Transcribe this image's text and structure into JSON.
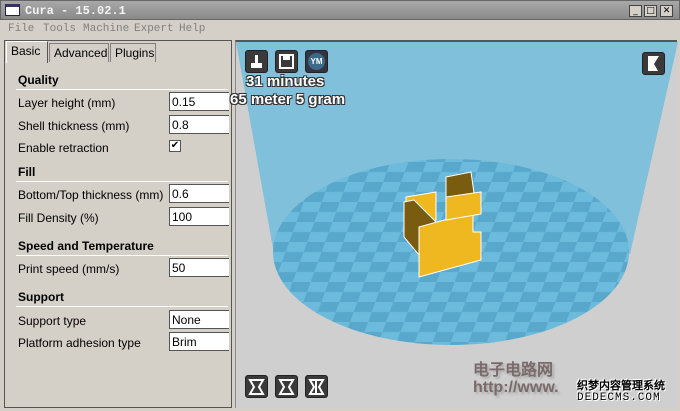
{
  "window": {
    "title": "Cura - 15.02.1"
  },
  "menu": [
    "File",
    "Tools",
    "Machine",
    "Expert",
    "Help"
  ],
  "tabs": [
    "Basic",
    "Advanced",
    "Plugins"
  ],
  "sections": {
    "quality": "Quality",
    "fill": "Fill",
    "speed": "Speed and Temperature",
    "support": "Support"
  },
  "fields": {
    "layer_height": {
      "label": "Layer height (mm)",
      "value": "0.15"
    },
    "shell_thickness": {
      "label": "Shell thickness (mm)",
      "value": "0.8"
    },
    "retraction": {
      "label": "Enable retraction",
      "checked": true,
      "mark": "✔"
    },
    "bottom_top": {
      "label": "Bottom/Top thickness (mm)",
      "value": "0.6"
    },
    "fill_density": {
      "label": "Fill Density (%)",
      "value": "100"
    },
    "print_speed": {
      "label": "Print speed (mm/s)",
      "value": "50"
    },
    "support_type": {
      "label": "Support type",
      "value": "None"
    },
    "adhesion": {
      "label": "Platform adhesion type",
      "value": "Brim"
    }
  },
  "viewport": {
    "time": "31 minutes",
    "material": "65 meter 5 gram",
    "ym_label": "YM",
    "colors": {
      "sky": "#80c0da",
      "bed": "#62b4d8",
      "model": "#f0b820"
    }
  },
  "watermark": {
    "line1": "电子电路网",
    "line2": "http://www.",
    "line3": "织梦内容管理系统",
    "line4": "DEDECMS.COM"
  }
}
